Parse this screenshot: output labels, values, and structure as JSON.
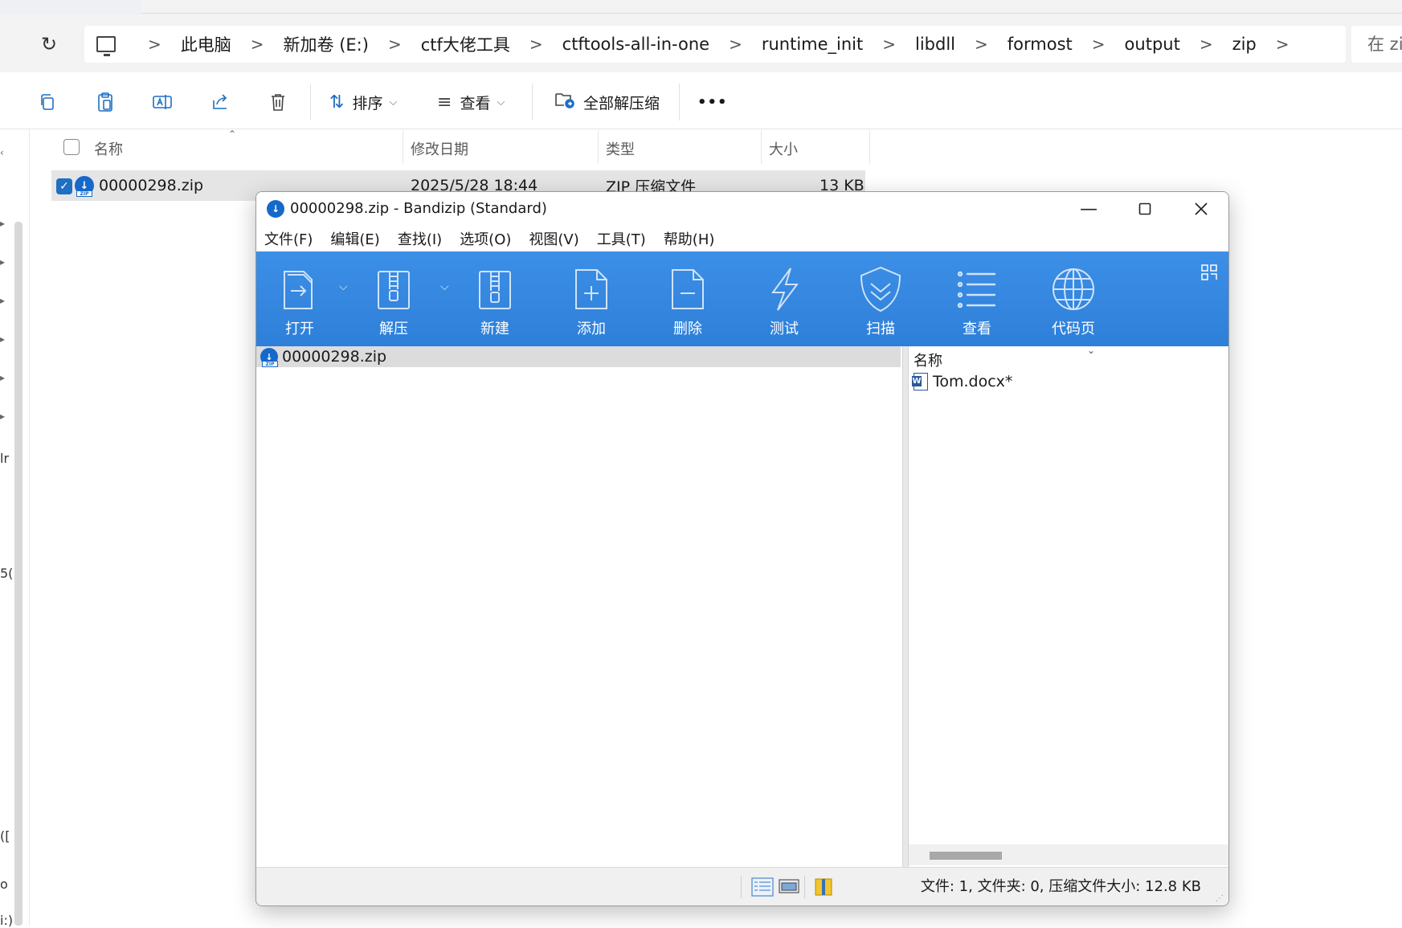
{
  "explorer": {
    "search_placeholder": "在 zi",
    "breadcrumbs": [
      "此电脑",
      "新加卷 (E:)",
      "ctf大佬工具",
      "ctftools-all-in-one",
      "runtime_init",
      "libdll",
      "formost",
      "output",
      "zip"
    ],
    "toolbar": {
      "sort_label": "排序",
      "view_label": "查看",
      "extract_all_label": "全部解压缩",
      "more_label": "•••"
    },
    "columns": {
      "name": "名称",
      "modified": "修改日期",
      "type": "类型",
      "size": "大小"
    },
    "rows": [
      {
        "name": "00000298.zip",
        "modified": "2025/5/28 18:44",
        "type": "ZIP 压缩文件",
        "size": "13 KB"
      }
    ],
    "left_fragments": [
      "lr",
      "5(",
      "([",
      "o",
      "i:)"
    ]
  },
  "bandizip": {
    "title": "00000298.zip - Bandizip (Standard)",
    "menu": [
      "文件(F)",
      "编辑(E)",
      "查找(I)",
      "选项(O)",
      "视图(V)",
      "工具(T)",
      "帮助(H)"
    ],
    "ribbon": [
      {
        "label": "打开",
        "icon": "open-icon"
      },
      {
        "label": "解压",
        "icon": "extract-icon"
      },
      {
        "label": "新建",
        "icon": "new-archive-icon"
      },
      {
        "label": "添加",
        "icon": "add-file-icon"
      },
      {
        "label": "删除",
        "icon": "delete-file-icon"
      },
      {
        "label": "测试",
        "icon": "test-icon"
      },
      {
        "label": "扫描",
        "icon": "scan-shield-icon"
      },
      {
        "label": "查看",
        "icon": "view-list-icon"
      },
      {
        "label": "代码页",
        "icon": "globe-icon"
      }
    ],
    "tree_item": "00000298.zip",
    "list_header": "名称",
    "files": [
      "Tom.docx*"
    ],
    "status": "文件: 1, 文件夹: 0, 压缩文件大小: 12.8 KB",
    "colors": {
      "ribbon": "#2e7fd9",
      "accent": "#1669c9"
    }
  }
}
